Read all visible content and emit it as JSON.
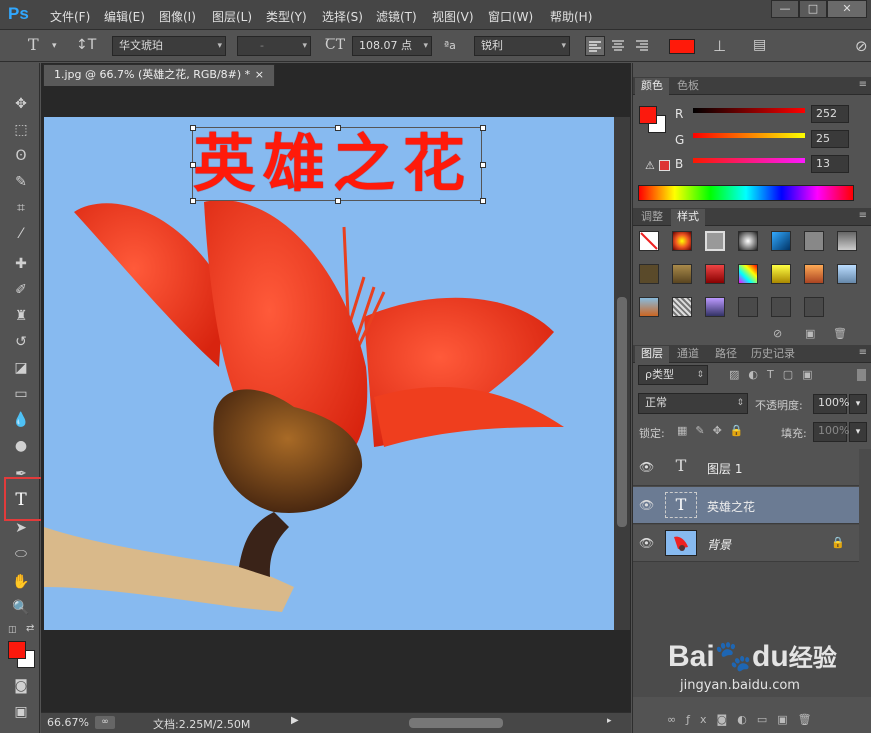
{
  "app": {
    "logo": "Ps"
  },
  "menu": [
    "文件(F)",
    "编辑(E)",
    "图像(I)",
    "图层(L)",
    "类型(Y)",
    "选择(S)",
    "滤镜(T)",
    "视图(V)",
    "窗口(W)",
    "帮助(H)"
  ],
  "window_buttons": [
    "—",
    "□",
    "✕"
  ],
  "options": {
    "tool_icon": "T",
    "font_family": "华文琥珀",
    "font_style": "-",
    "font_size": "108.07 点",
    "aa_label": "ªa",
    "aa_mode": "锐利",
    "text_color": "#ff1a0a"
  },
  "document": {
    "tab_title": "1.jpg @ 66.7% (英雄之花, RGB/8#) *",
    "close": "×",
    "text_layer_content": "英雄之花"
  },
  "status": {
    "zoom": "66.67%",
    "doc_info": "文档:2.25M/2.50M"
  },
  "color_panel": {
    "tabs": [
      "颜色",
      "色板"
    ],
    "channels": [
      {
        "label": "R",
        "value": "252"
      },
      {
        "label": "G",
        "value": "25"
      },
      {
        "label": "B",
        "value": "13"
      }
    ],
    "foreground": "#fc190d",
    "background": "#ffffff"
  },
  "styles_panel": {
    "tabs": [
      "调整",
      "样式"
    ]
  },
  "layers_panel": {
    "tabs": [
      "图层",
      "通道",
      "路径",
      "历史记录"
    ],
    "filter_label": "ρ类型",
    "blend_mode": "正常",
    "opacity_label": "不透明度:",
    "opacity": "100%",
    "lock_label": "锁定:",
    "fill_label": "填充:",
    "fill": "100%",
    "layers": [
      {
        "name": "图层 1",
        "thumb": "T"
      },
      {
        "name": "英雄之花",
        "thumb": "T"
      },
      {
        "name": "背景",
        "thumb": ""
      }
    ]
  },
  "watermark": {
    "brand": "Bai",
    "brand2": "du",
    "suffix": "经验",
    "url": "jingyan.baidu.com"
  }
}
